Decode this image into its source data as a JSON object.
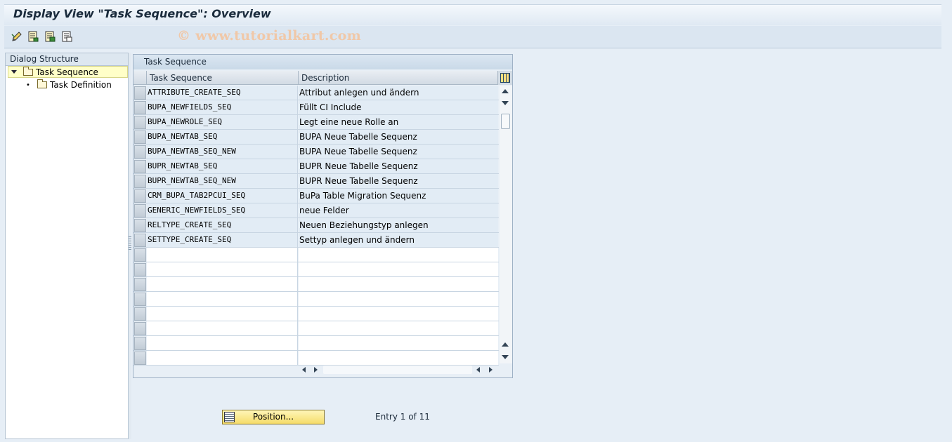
{
  "window": {
    "title": "Display View \"Task Sequence\": Overview"
  },
  "toolbar": {
    "icons": [
      "display-change-icon",
      "detail-icon",
      "select-all-icon",
      "deselect-all-icon"
    ],
    "watermark": "© www.tutorialkart.com"
  },
  "dialog_structure": {
    "header": "Dialog Structure",
    "items": [
      {
        "label": "Task Sequence",
        "selected": true,
        "expanded": true
      },
      {
        "label": "Task Definition",
        "selected": false
      }
    ]
  },
  "table": {
    "caption": "Task Sequence",
    "columns": [
      "Task Sequence",
      "Description"
    ],
    "rows": [
      {
        "seq": "ATTRIBUTE_CREATE_SEQ",
        "desc": "Attribut anlegen und ändern"
      },
      {
        "seq": "BUPA_NEWFIELDS_SEQ",
        "desc": "Füllt CI Include"
      },
      {
        "seq": "BUPA_NEWROLE_SEQ",
        "desc": "Legt eine neue Rolle an"
      },
      {
        "seq": "BUPA_NEWTAB_SEQ",
        "desc": "BUPA Neue Tabelle Sequenz"
      },
      {
        "seq": "BUPA_NEWTAB_SEQ_NEW",
        "desc": "BUPA Neue Tabelle Sequenz"
      },
      {
        "seq": "BUPR_NEWTAB_SEQ",
        "desc": "BUPR Neue Tabelle Sequenz"
      },
      {
        "seq": "BUPR_NEWTAB_SEQ_NEW",
        "desc": "BUPR Neue Tabelle Sequenz"
      },
      {
        "seq": "CRM_BUPA_TAB2PCUI_SEQ",
        "desc": "BuPa Table Migration Sequenz"
      },
      {
        "seq": "GENERIC_NEWFIELDS_SEQ",
        "desc": "neue Felder"
      },
      {
        "seq": "RELTYPE_CREATE_SEQ",
        "desc": "Neuen Beziehungstyp anlegen"
      },
      {
        "seq": "SETTYPE_CREATE_SEQ",
        "desc": "Settyp anlegen und ändern"
      }
    ],
    "empty_rows": 8
  },
  "footer": {
    "position_button": "Position...",
    "entry_text": "Entry 1 of 11"
  },
  "colors": {
    "background": "#e6eef6",
    "selected_tree_item": "#ffffc8",
    "button_yellow": "#f5dc6a"
  }
}
